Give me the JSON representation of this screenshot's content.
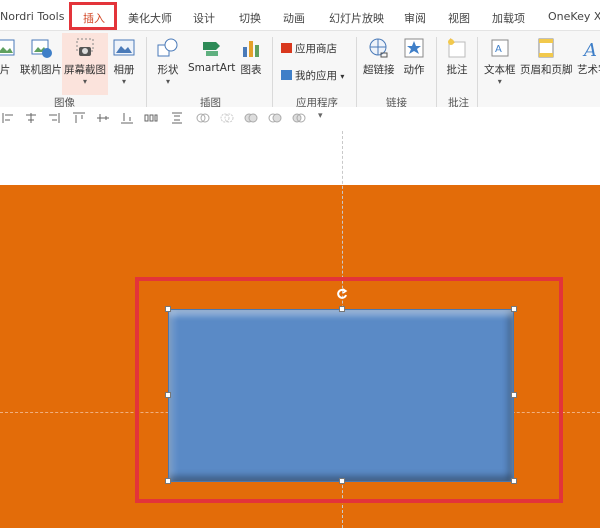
{
  "tabs": [
    "Nordri Tools",
    "插入",
    "美化大师",
    "设计",
    "切换",
    "动画",
    "幻灯片放映",
    "审阅",
    "视图",
    "加载项",
    "OneKey X"
  ],
  "active_tab": "插入",
  "ribbon": {
    "images_group": {
      "label": "图像",
      "buttons": [
        "片",
        "联机图片",
        "屏幕截图",
        "相册"
      ]
    },
    "illustrations_group": {
      "label": "插图",
      "buttons": [
        "形状",
        "SmartArt",
        "图表"
      ]
    },
    "apps_group": {
      "label": "应用程序",
      "store": "应用商店",
      "my_apps": "我的应用"
    },
    "links_group": {
      "label": "链接",
      "buttons": [
        "超链接",
        "动作"
      ]
    },
    "comments_group": {
      "label": "批注",
      "buttons": [
        "批注"
      ]
    },
    "text_group": {
      "buttons": [
        "文本框",
        "页眉和页脚",
        "艺术字"
      ]
    }
  },
  "colors": {
    "slide_background": "#e36c09",
    "shape_fill": "#5a8ac6",
    "highlight": "#e3343a",
    "active_tab_text": "#d24726"
  }
}
